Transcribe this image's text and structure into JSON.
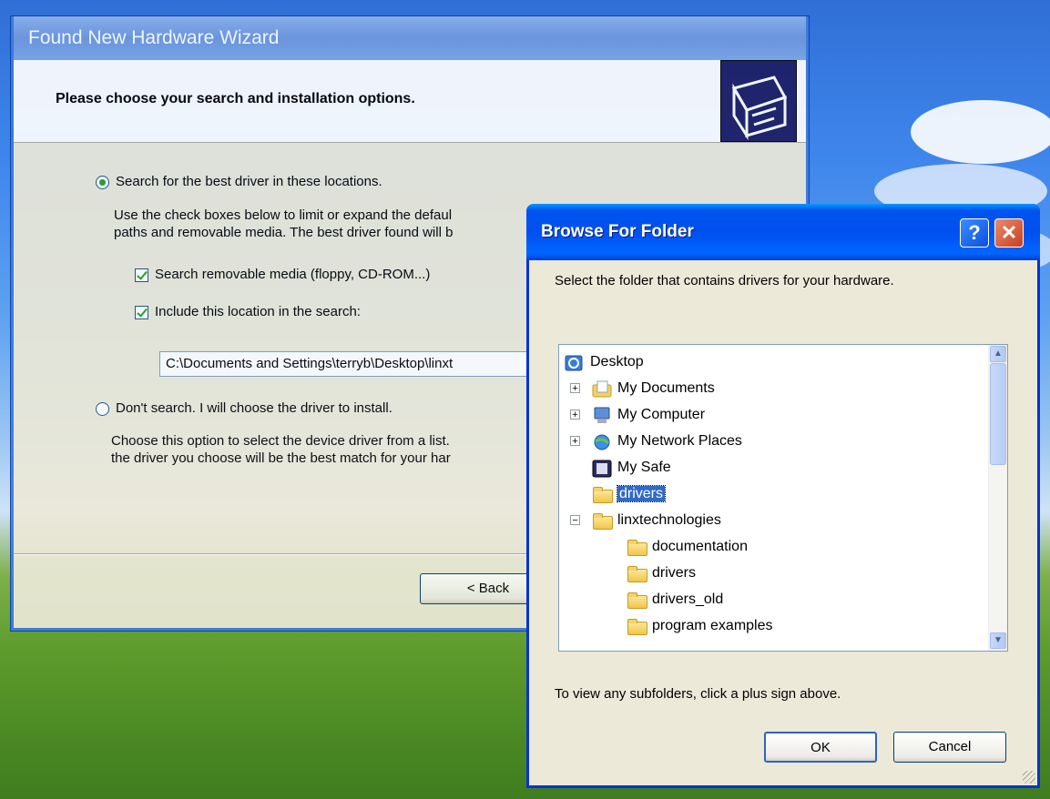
{
  "wizard": {
    "title": "Found New Hardware Wizard",
    "heading": "Please choose your search and installation options.",
    "option_search": "Search for the best driver in these locations.",
    "search_desc_1": "Use the check boxes below to limit or expand the defaul",
    "search_desc_2": "paths and removable media. The best driver found will b",
    "check_removable": "Search removable media (floppy, CD-ROM...)",
    "check_include": "Include this location in the search:",
    "path_value": "C:\\Documents and Settings\\terryb\\Desktop\\linxt",
    "option_dont_search": "Don't search. I will choose the driver to install.",
    "dont_desc_1": "Choose this option to select the device driver from a list.",
    "dont_desc_2": "the driver you choose will be the best match for your har",
    "back_label": "< Back"
  },
  "browse": {
    "title": "Browse For Folder",
    "help_label": "?",
    "close_label": "✕",
    "prompt": "Select the folder that contains drivers for your hardware.",
    "tree": [
      {
        "label": "Desktop"
      },
      {
        "label": "My Documents"
      },
      {
        "label": "My Computer"
      },
      {
        "label": "My Network Places"
      },
      {
        "label": "My Safe"
      },
      {
        "label": "drivers"
      },
      {
        "label": "linxtechnologies"
      },
      {
        "label": "documentation"
      },
      {
        "label": "drivers"
      },
      {
        "label": "drivers_old"
      },
      {
        "label": "program examples"
      }
    ],
    "hint": "To view any subfolders, click a plus sign above.",
    "ok_label": "OK",
    "cancel_label": "Cancel"
  },
  "icons": {
    "plus": "+",
    "minus": "−",
    "scroll_up": "▲",
    "scroll_down": "▼"
  }
}
